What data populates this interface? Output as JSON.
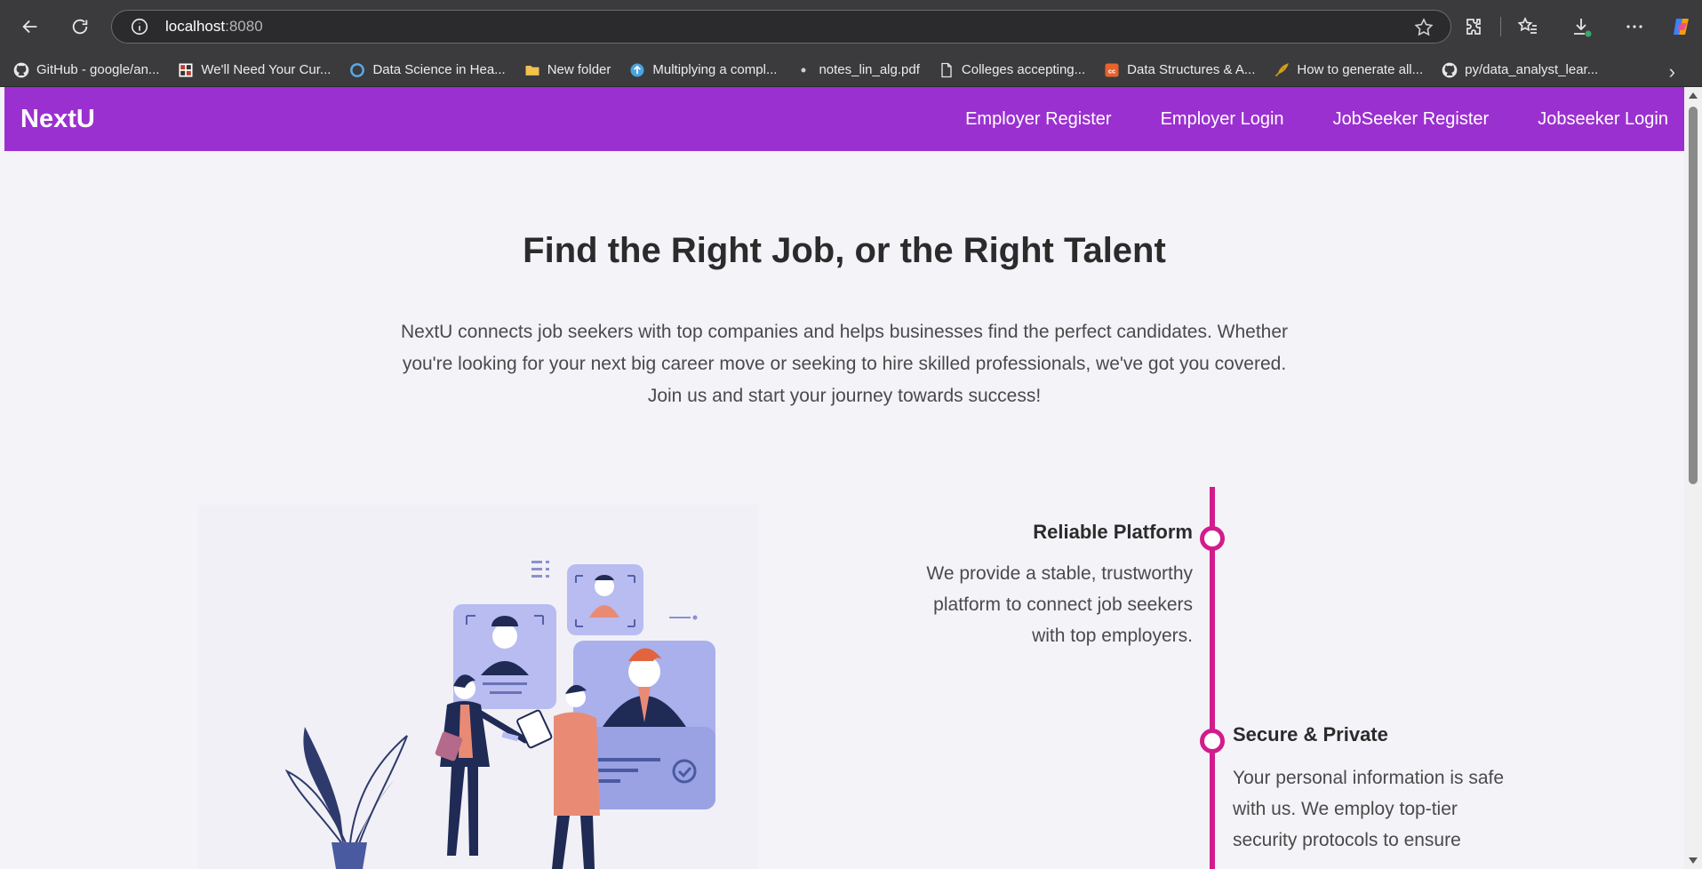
{
  "browser": {
    "url_host": "localhost",
    "url_port": ":8080",
    "bookmarks": [
      {
        "label": "GitHub - google/an...",
        "icon": "github-icon"
      },
      {
        "label": "We'll Need Your Cur...",
        "icon": "grid-logo-icon"
      },
      {
        "label": "Data Science in Hea...",
        "icon": "edge-ring-icon"
      },
      {
        "label": "New folder",
        "icon": "folder-icon"
      },
      {
        "label": "Multiplying a compl...",
        "icon": "upload-circle-icon"
      },
      {
        "label": "notes_lin_alg.pdf",
        "icon": "dot-icon"
      },
      {
        "label": "Colleges accepting...",
        "icon": "document-icon"
      },
      {
        "label": "Data Structures & A...",
        "icon": "cc-logo-icon"
      },
      {
        "label": "How to generate all...",
        "icon": "feather-icon"
      },
      {
        "label": "py/data_analyst_lear...",
        "icon": "github-icon"
      }
    ]
  },
  "site": {
    "brand": "NextU",
    "nav": [
      "Employer Register",
      "Employer Login",
      "JobSeeker Register",
      "Jobseeker Login"
    ],
    "hero_title": "Find the Right Job, or the Right Talent",
    "hero_text": "NextU connects job seekers with top companies and helps businesses find the perfect candidates. Whether you're looking for your next big career move or seeking to hire skilled professionals, we've got you covered. Join us and start your journey towards success!",
    "features": [
      {
        "title": "Reliable Platform",
        "text": "We provide a stable, trustworthy platform to connect job seekers with top employers."
      },
      {
        "title": "Secure & Private",
        "text": "Your personal information is safe with us. We employ top-tier security protocols to ensure"
      }
    ]
  },
  "colors": {
    "header_bg": "#9b30d0",
    "timeline": "#d21c8c",
    "page_bg": "#f4f3f8"
  }
}
